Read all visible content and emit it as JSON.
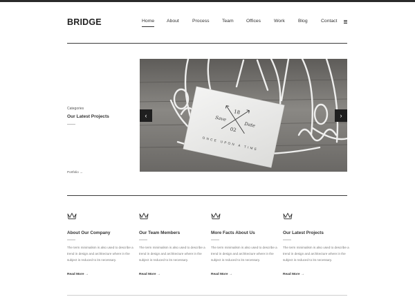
{
  "brand": {
    "name": "BRIDGE"
  },
  "nav": {
    "items": [
      {
        "label": "Home",
        "active": true
      },
      {
        "label": "About"
      },
      {
        "label": "Process"
      },
      {
        "label": "Team"
      },
      {
        "label": "Offices"
      },
      {
        "label": "Work"
      },
      {
        "label": "Blog"
      },
      {
        "label": "Contact"
      }
    ],
    "menu_icon": "hamburger-icon"
  },
  "intro": {
    "category_label": "Categories",
    "title": "Our Latest Projects",
    "link_label": "Portfolio →"
  },
  "slider": {
    "card_text": "ONCE UPON A TIME",
    "card_numbers": [
      "18",
      "02"
    ],
    "card_script": [
      "Save",
      "Date"
    ],
    "prev_icon": "chevron-left-icon",
    "next_icon": "chevron-right-icon"
  },
  "features": [
    {
      "icon": "crown-icon",
      "title": "About Our Company",
      "text": "The term minimalism is also used to describe a trend in design and architecture where in the subject is reduced to its necessary.",
      "link": "Read More →"
    },
    {
      "icon": "crown-icon",
      "title": "Our Team Members",
      "text": "The term minimalism is also used to describe a trend in design and architecture where in the subject is reduced to its necessary.",
      "link": "Read More →"
    },
    {
      "icon": "crown-icon",
      "title": "More Facts About Us",
      "text": "The term minimalism is also used to describe a trend in design and architecture where in the subject is reduced to its necessary.",
      "link": "Read More →"
    },
    {
      "icon": "crown-icon",
      "title": "Our Latest Projects",
      "text": "The term minimalism is also used to describe a trend in design and architecture where in the subject is reduced to its necessary.",
      "link": "Read More →"
    }
  ],
  "colors": {
    "text": "#303030",
    "topbar": "#2a2a2a",
    "arrow_bg": "#1f1f1f"
  }
}
